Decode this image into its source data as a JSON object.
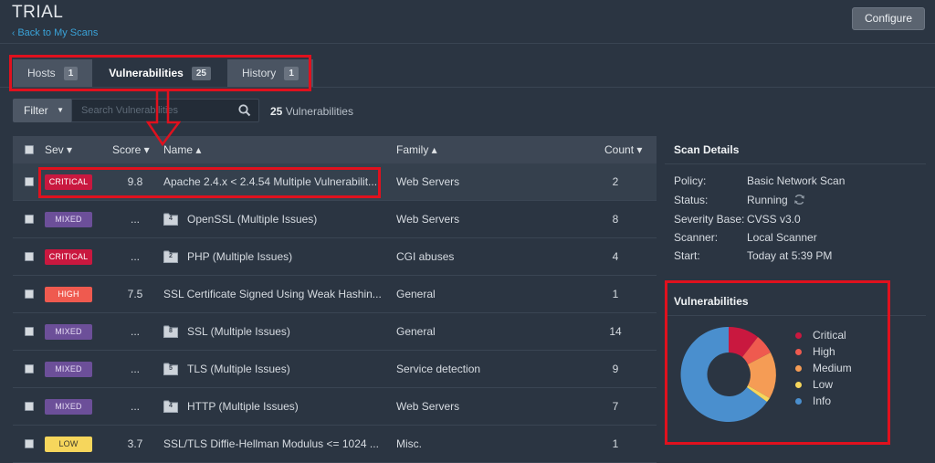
{
  "header": {
    "title": "TRIAL",
    "back_link": "Back to My Scans",
    "configure_label": "Configure"
  },
  "tabs": [
    {
      "label": "Hosts",
      "count": "1"
    },
    {
      "label": "Vulnerabilities",
      "count": "25"
    },
    {
      "label": "History",
      "count": "1"
    }
  ],
  "filter": {
    "label": "Filter",
    "search_placeholder": "Search Vulnerabilities",
    "count_value": "25",
    "count_suffix": "Vulnerabilities"
  },
  "table": {
    "headers": {
      "sev": "Sev ▾",
      "score": "Score ▾",
      "name": "Name ▴",
      "family": "Family ▴",
      "count": "Count ▾"
    },
    "rows": [
      {
        "sev": "CRITICAL",
        "score": "9.8",
        "name": "Apache 2.4.x < 2.4.54 Multiple Vulnerabilit...",
        "family": "Web Servers",
        "count": "2"
      },
      {
        "sev": "MIXED",
        "score": "...",
        "folder": "4",
        "name": "OpenSSL (Multiple Issues)",
        "family": "Web Servers",
        "count": "8"
      },
      {
        "sev": "CRITICAL",
        "score": "...",
        "folder": "2",
        "name": "PHP (Multiple Issues)",
        "family": "CGI abuses",
        "count": "4"
      },
      {
        "sev": "HIGH",
        "score": "7.5",
        "name": "SSL Certificate Signed Using Weak Hashin...",
        "family": "General",
        "count": "1"
      },
      {
        "sev": "MIXED",
        "score": "...",
        "folder": "8",
        "name": "SSL (Multiple Issues)",
        "family": "General",
        "count": "14"
      },
      {
        "sev": "MIXED",
        "score": "...",
        "folder": "5",
        "name": "TLS (Multiple Issues)",
        "family": "Service detection",
        "count": "9"
      },
      {
        "sev": "MIXED",
        "score": "...",
        "folder": "4",
        "name": "HTTP (Multiple Issues)",
        "family": "Web Servers",
        "count": "7"
      },
      {
        "sev": "LOW",
        "score": "3.7",
        "name": "SSL/TLS Diffie-Hellman Modulus <= 1024 ...",
        "family": "Misc.",
        "count": "1"
      }
    ]
  },
  "scan_details": {
    "title": "Scan Details",
    "items": [
      {
        "label": "Policy:",
        "value": "Basic Network Scan"
      },
      {
        "label": "Status:",
        "value": "Running"
      },
      {
        "label": "Severity Base:",
        "value": "CVSS v3.0"
      },
      {
        "label": "Scanner:",
        "value": "Local Scanner"
      },
      {
        "label": "Start:",
        "value": "Today at 5:39 PM"
      }
    ]
  },
  "vulnerabilities_chart": {
    "title": "Vulnerabilities",
    "legend": [
      {
        "label": "Critical",
        "color": "#c9183f"
      },
      {
        "label": "High",
        "color": "#ef5a4f"
      },
      {
        "label": "Medium",
        "color": "#f59c55"
      },
      {
        "label": "Low",
        "color": "#f6d65c"
      },
      {
        "label": "Info",
        "color": "#4a8fce"
      }
    ]
  },
  "colors": {
    "accent_link": "#3aa3d8",
    "annotation_red": "#e0111e"
  }
}
